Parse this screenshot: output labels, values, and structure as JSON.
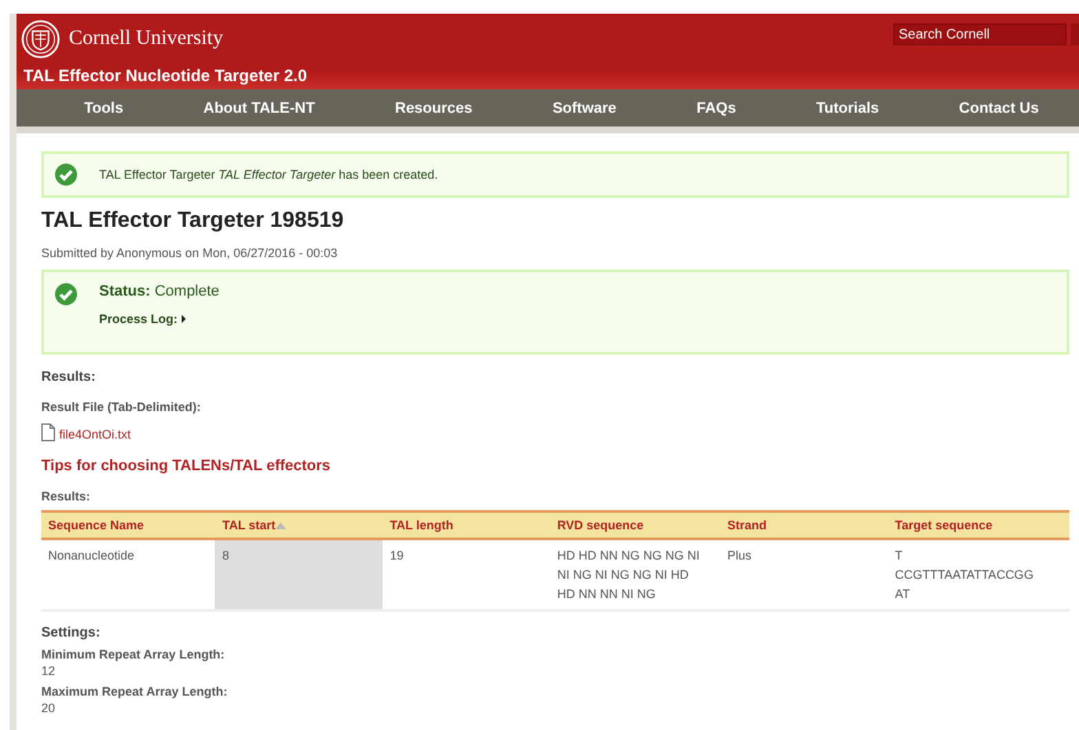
{
  "header": {
    "university": "Cornell University",
    "site_title": "TAL Effector Nucleotide Targeter 2.0",
    "search": {
      "placeholder": "Search Cornell"
    }
  },
  "nav": [
    "Tools",
    "About TALE-NT",
    "Resources",
    "Software",
    "FAQs",
    "Tutorials",
    "Contact Us"
  ],
  "message": {
    "prefix": "TAL Effector Targeter ",
    "emphasis": "TAL Effector Targeter",
    "suffix": " has been created."
  },
  "page_title": "TAL Effector Targeter 198519",
  "submitted": "Submitted by Anonymous on Mon, 06/27/2016 - 00:03",
  "status": {
    "label": "Status:",
    "value": "Complete",
    "log_label": "Process Log:",
    "log_expanded": false
  },
  "results": {
    "heading": "Results:",
    "file_label": "Result File (Tab-Delimited):",
    "file": "file4OntOi.txt",
    "tips": "Tips for choosing TALENs/TAL effectors",
    "table_label": "Results:"
  },
  "table": {
    "columns": [
      {
        "label": "Sequence Name",
        "sorted": false
      },
      {
        "label": "TAL start",
        "sorted": true
      },
      {
        "label": "TAL length",
        "sorted": false
      },
      {
        "label": "RVD sequence",
        "sorted": false
      },
      {
        "label": "Strand",
        "sorted": false
      },
      {
        "label": "Target sequence",
        "sorted": false
      }
    ],
    "rows": [
      [
        [
          "Nonanucleotide"
        ],
        [
          "8"
        ],
        [
          "19"
        ],
        [
          "HD HD NN NG NG NG NI",
          "NI NG NI NG NG NI HD",
          "HD NN NN NI NG"
        ],
        [
          "Plus"
        ],
        [
          "T",
          "CCGTTTAATATTACCGG",
          "AT"
        ]
      ]
    ]
  },
  "settings": {
    "heading": "Settings:",
    "items": [
      {
        "label": "Minimum Repeat Array Length:",
        "value": "12"
      },
      {
        "label": "Maximum Repeat Array Length:",
        "value": "20"
      }
    ]
  }
}
